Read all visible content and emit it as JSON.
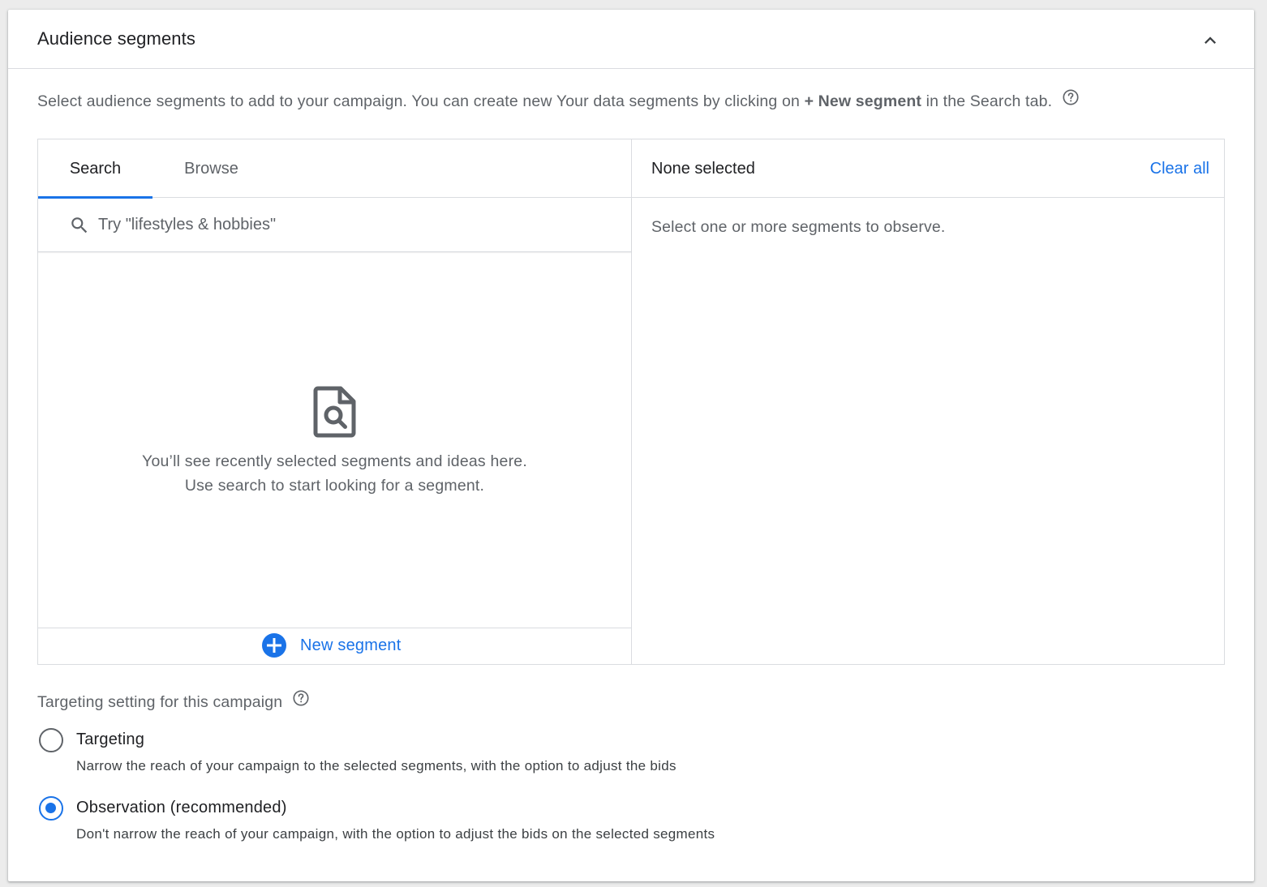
{
  "header": {
    "title": "Audience segments",
    "collapse_icon": "chevron-up-icon"
  },
  "intro": {
    "text_before": "Select audience segments to add to your campaign. You can create new Your data segments by clicking on",
    "text_bold": "+ New segment",
    "text_after": "in the Search tab.",
    "help_icon": "help-circle-icon"
  },
  "tabs": [
    {
      "label": "Search",
      "active": true
    },
    {
      "label": "Browse",
      "active": false
    }
  ],
  "search": {
    "placeholder": "Try \"lifestyles & hobbies\"",
    "value": "",
    "icon": "search-icon"
  },
  "empty_state": {
    "icon": "find-in-page-icon",
    "line1": "You’ll see recently selected segments and ideas here.",
    "line2": "Use search to start looking for a segment."
  },
  "new_segment": {
    "label": "New segment",
    "icon": "add-circle-icon"
  },
  "selected_panel": {
    "title": "None selected",
    "clear_all_label": "Clear all",
    "empty_text": "Select one or more segments to observe."
  },
  "targeting": {
    "title": "Targeting setting for this campaign",
    "help_icon": "help-circle-icon",
    "options": [
      {
        "label": "Targeting",
        "description": "Narrow the reach of your campaign to the selected segments, with the option to adjust the bids",
        "selected": false
      },
      {
        "label": "Observation (recommended)",
        "description": "Don't narrow the reach of your campaign, with the option to adjust the bids on the selected segments",
        "selected": true
      }
    ]
  },
  "colors": {
    "accent": "#1a73e8",
    "text_primary": "#202124",
    "text_secondary": "#5f6368",
    "divider": "#dadce0"
  }
}
